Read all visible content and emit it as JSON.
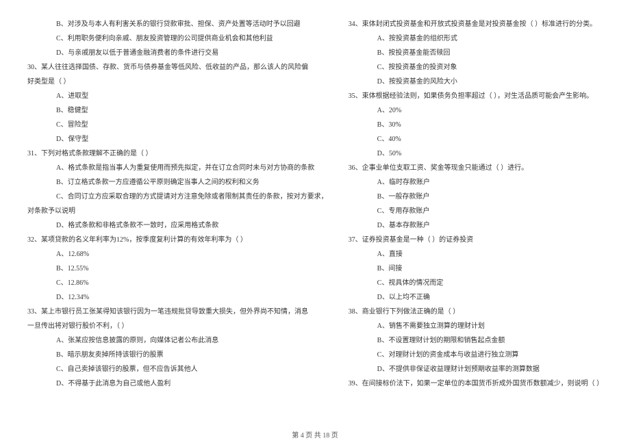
{
  "left": {
    "l1": "B、对涉及与本人有利害关系的银行贷款审批、担保、资产处置等活动时予以回避",
    "l2": "C、利用职务便利向亲戚、朋友投资管理的公司提供商业机会和其他利益",
    "l3": "D、与亲戚朋友以低于普通金融消费者的条件进行交易",
    "q30": "30、某人往往选择国债、存款、货币与债券基金等低风险、低收益的产品，那么该人的风险偏",
    "q30b": "好类型是（      ）",
    "q30_a": "A、进取型",
    "q30_b": "B、稳健型",
    "q30_c": "C、冒险型",
    "q30_d": "D、保守型",
    "q31": "31、下列对格式条款理解不正确的是（      ）",
    "q31_a": "A、格式条款是指当事人为重复使用而预先拟定，并在订立合同时未与对方协商的条款",
    "q31_b": "B、订立格式条款一方应遵循公平原则确定当事人之间的权利和义务",
    "q31_c": "C、合同订立方应采取合理的方式提请对方注意免除或者限制其责任的条款，按对方要求，",
    "q31_c2": "对条款予以说明",
    "q31_d": "D、格式条款和非格式条款不一致时，应采用格式条款",
    "q32": "32、某项贷款的名义年利率为12%，按季度复利计算的有效年利率为（      ）",
    "q32_a": "A、12.68%",
    "q32_b": "B、12.55%",
    "q32_c": "C、12.86%",
    "q32_d": "D、12.34%",
    "q33": "33、某上市银行员工张某得知该银行因为一笔违规批贷导致重大损失，但外界尚不知情，消息",
    "q33b": "一旦传出将对银行股价不利，（      ）",
    "q33_a": "A、张某应按信息披露的原则，向媒体记者公布此消息",
    "q33_b": "B、暗示朋友卖掉所持该银行的股票",
    "q33_c": "C、自己卖掉该银行的股票，但不应告诉其他人",
    "q33_d": "D、不得基于此消息为自己或他人盈利"
  },
  "right": {
    "q34": "34、束体封闭式投资基金和开放式投资基金是对投资基金按（      ）标准进行的分类。",
    "q34_a": "A、按投资基金的组织形式",
    "q34_b": "B、按投资基金能否赎回",
    "q34_c": "C、按投资基金的投资对象",
    "q34_d": "D、按投资基金的风险大小",
    "q35": "35、束体根据经验法则，如果债务负担率超过（      ），对生活品质可能会产生影响。",
    "q35_a": "A、20%",
    "q35_b": "B、30%",
    "q35_c": "C、40%",
    "q35_d": "D、50%",
    "q36": "36、企事业单位支取工资、奖金等现金只能通过（      ）进行。",
    "q36_a": "A、临时存款账户",
    "q36_b": "B、一般存款账户",
    "q36_c": "C、专用存款账户",
    "q36_d": "D、基本存款账户",
    "q37": "37、证券投资基金是一种（      ）的证券投资",
    "q37_a": "A、直接",
    "q37_b": "B、间接",
    "q37_c": "C、视具体的情况而定",
    "q37_d": "D、以上均不正确",
    "q38": "38、商业银行下列做法正确的是（      ）",
    "q38_a": "A、销售不需要独立测算的理财计划",
    "q38_b": "B、不设置理财计划的期限和销售起点金额",
    "q38_c": "C、对理财计划的资金成本与收益进行独立测算",
    "q38_d": "D、不提供非保证收益理财计划预期收益率的测算数据",
    "q39": "39、在间接标价法下，如果一定单位的本国货币折成外国货币数额减少，则说明（      ）"
  },
  "footer": "第 4 页 共 18 页"
}
